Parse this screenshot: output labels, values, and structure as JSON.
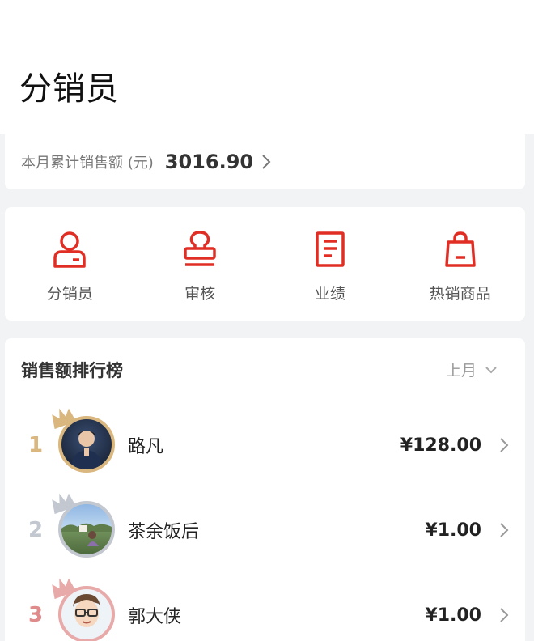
{
  "header": {
    "title": "分销员"
  },
  "summary": {
    "label": "本月累计销售额 (元)",
    "value": "3016.90",
    "chevron_icon": "chevron-right-icon"
  },
  "menu": {
    "accent_color": "#e02e24",
    "items": [
      {
        "label": "分销员",
        "icon": "person-icon"
      },
      {
        "label": "审核",
        "icon": "stamp-icon"
      },
      {
        "label": "业绩",
        "icon": "document-icon"
      },
      {
        "label": "热销商品",
        "icon": "shopping-bag-icon"
      }
    ]
  },
  "ranking": {
    "title": "销售额排行榜",
    "period": "上月",
    "rows": [
      {
        "rank": "1",
        "name": "路凡",
        "amount": "¥128.00",
        "medal_color": "#d9b77f"
      },
      {
        "rank": "2",
        "name": "茶余饭后",
        "amount": "¥1.00",
        "medal_color": "#c3c8d0"
      },
      {
        "rank": "3",
        "name": "郭大侠",
        "amount": "¥1.00",
        "medal_color": "#e8a9a9"
      }
    ]
  }
}
